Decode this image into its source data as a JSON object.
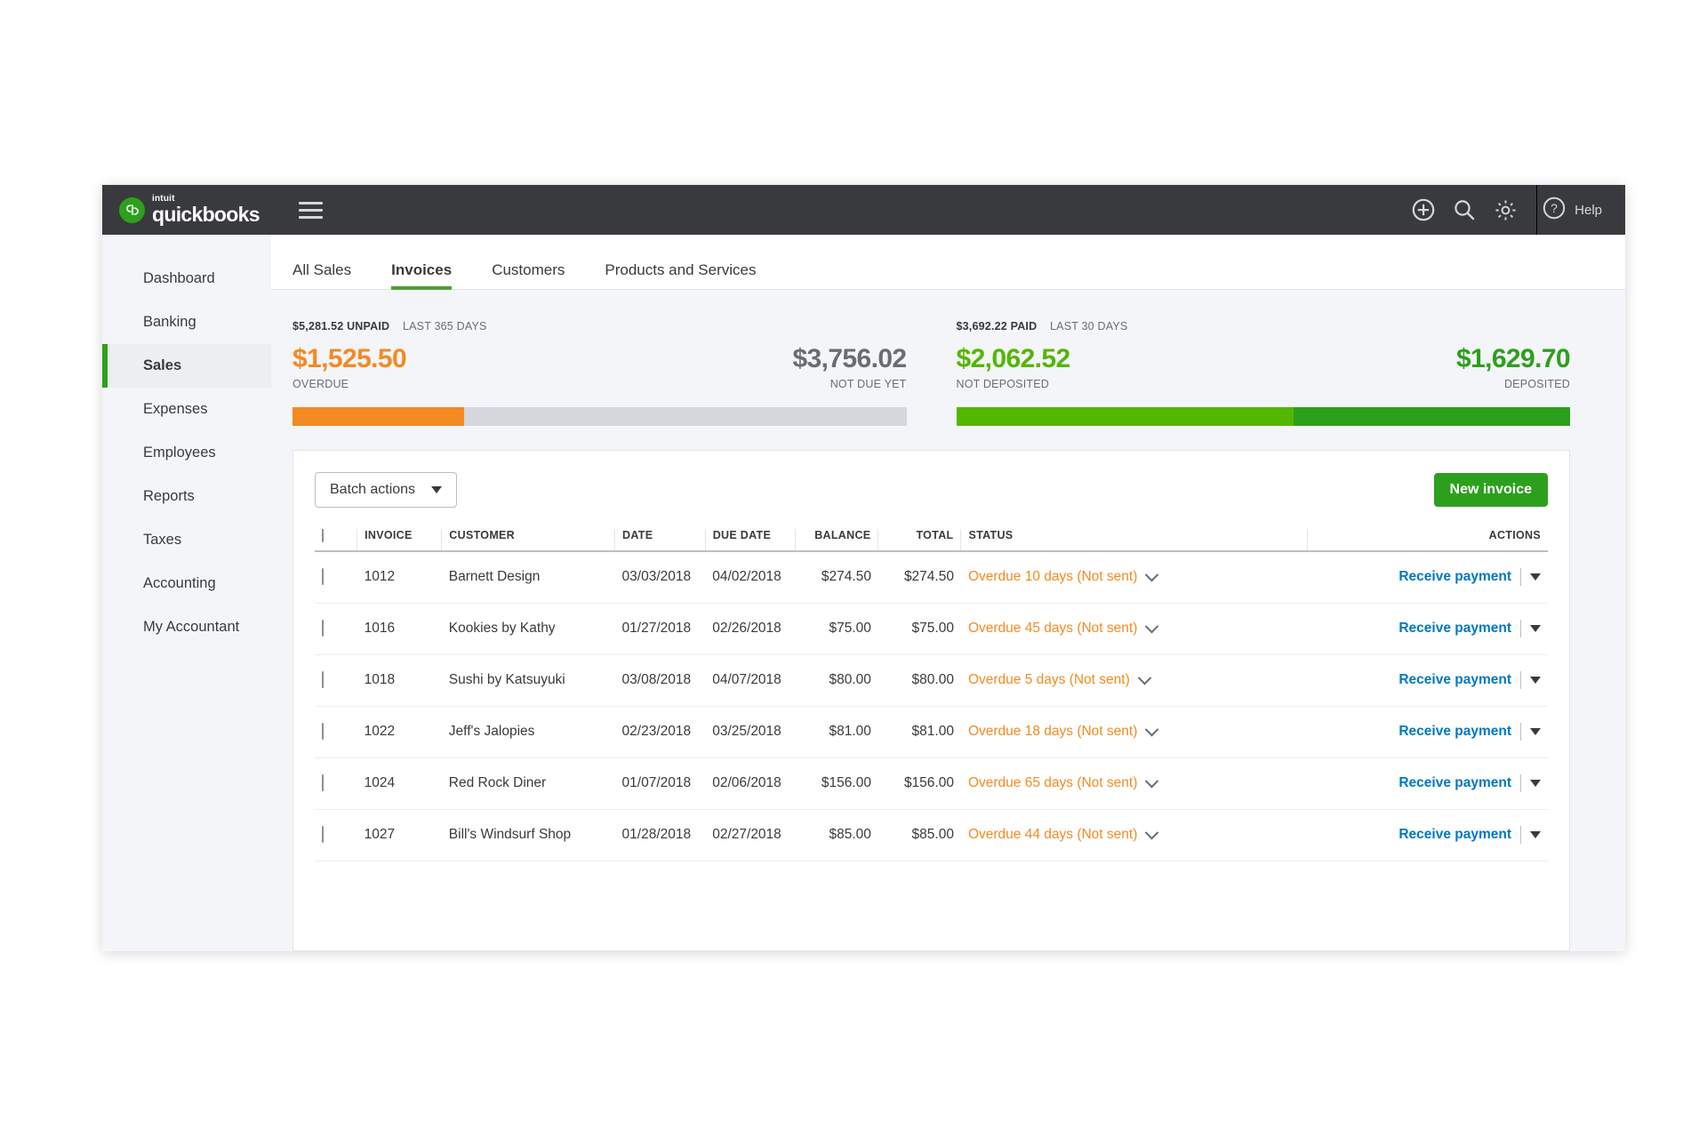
{
  "topbar": {
    "logo": {
      "intuit": "intuit",
      "product": "quickbooks"
    },
    "menu_icon": "hamburger-icon",
    "icons": [
      "plus-circle-icon",
      "search-icon",
      "gear-icon"
    ],
    "help_label": "Help",
    "colors": {
      "bar_bg": "#393a3d",
      "brand_green": "#2ca01c"
    }
  },
  "sidebar": {
    "items": [
      {
        "label": "Dashboard",
        "active": false
      },
      {
        "label": "Banking",
        "active": false
      },
      {
        "label": "Sales",
        "active": true
      },
      {
        "label": "Expenses",
        "active": false
      },
      {
        "label": "Employees",
        "active": false
      },
      {
        "label": "Reports",
        "active": false
      },
      {
        "label": "Taxes",
        "active": false
      },
      {
        "label": "Accounting",
        "active": false
      },
      {
        "label": "My Accountant",
        "active": false
      }
    ]
  },
  "tabs": [
    {
      "label": "All Sales",
      "active": false
    },
    {
      "label": "Invoices",
      "active": true
    },
    {
      "label": "Customers",
      "active": false
    },
    {
      "label": "Products and Services",
      "active": false
    }
  ],
  "summary": {
    "unpaid": {
      "total": "$5,281.52 UNPAID",
      "period": "LAST 365 DAYS",
      "left": {
        "amount": "$1,525.50",
        "label": "OVERDUE",
        "color": "#f28b22",
        "pct": 28
      },
      "right": {
        "amount": "$3,756.02",
        "label": "NOT DUE YET",
        "color": "#6b6c72",
        "pct": 72
      },
      "track_color": "#d4d7dc"
    },
    "paid": {
      "total": "$3,692.22 PAID",
      "period": "LAST 30 DAYS",
      "left": {
        "amount": "$2,062.52",
        "label": "NOT DEPOSITED",
        "color": "#53b700",
        "pct": 55
      },
      "right": {
        "amount": "$1,629.70",
        "label": "DEPOSITED",
        "color": "#2ca01c",
        "pct": 45
      }
    }
  },
  "toolbar": {
    "batch_actions_label": "Batch actions",
    "new_invoice_label": "New invoice"
  },
  "table": {
    "columns": [
      "INVOICE",
      "CUSTOMER",
      "DATE",
      "DUE DATE",
      "BALANCE",
      "TOTAL",
      "STATUS",
      "ACTIONS"
    ],
    "action_label": "Receive payment",
    "rows": [
      {
        "invoice": "1012",
        "customer": "Barnett Design",
        "date": "03/03/2018",
        "due_date": "04/02/2018",
        "balance": "$274.50",
        "total": "$274.50",
        "status": "Overdue 10 days (Not sent)"
      },
      {
        "invoice": "1016",
        "customer": "Kookies by Kathy",
        "date": "01/27/2018",
        "due_date": "02/26/2018",
        "balance": "$75.00",
        "total": "$75.00",
        "status": "Overdue 45 days (Not sent)"
      },
      {
        "invoice": "1018",
        "customer": "Sushi by Katsuyuki",
        "date": "03/08/2018",
        "due_date": "04/07/2018",
        "balance": "$80.00",
        "total": "$80.00",
        "status": "Overdue 5 days (Not sent)"
      },
      {
        "invoice": "1022",
        "customer": "Jeff's Jalopies",
        "date": "02/23/2018",
        "due_date": "03/25/2018",
        "balance": "$81.00",
        "total": "$81.00",
        "status": "Overdue 18 days (Not sent)"
      },
      {
        "invoice": "1024",
        "customer": "Red Rock Diner",
        "date": "01/07/2018",
        "due_date": "02/06/2018",
        "balance": "$156.00",
        "total": "$156.00",
        "status": "Overdue 65 days (Not sent)"
      },
      {
        "invoice": "1027",
        "customer": "Bill's Windsurf Shop",
        "date": "01/28/2018",
        "due_date": "02/27/2018",
        "balance": "$85.00",
        "total": "$85.00",
        "status": "Overdue 44 days (Not sent)"
      }
    ]
  }
}
